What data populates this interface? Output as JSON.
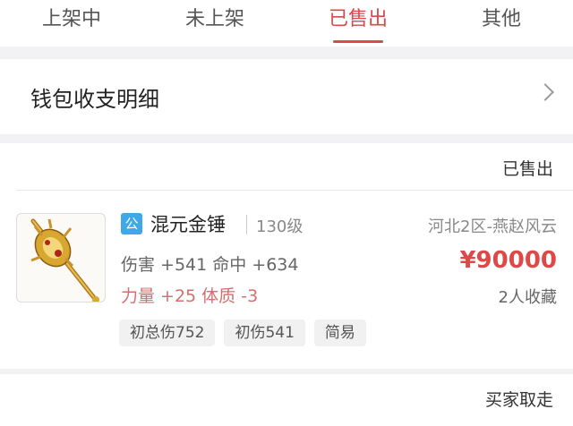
{
  "tabs": [
    {
      "label": "上架中"
    },
    {
      "label": "未上架"
    },
    {
      "label": "已售出"
    },
    {
      "label": "其他"
    }
  ],
  "active_tab": "已售出",
  "wallet": {
    "label": "钱包收支明细",
    "icon": "chevron-right-icon"
  },
  "order": {
    "status": "已售出",
    "item": {
      "badge": "公",
      "name": "混元金锤",
      "level": "130级",
      "server": "河北2区-燕赵风云",
      "stats_line1": "伤害 +541 命中 +634",
      "stats_line2": "力量 +25 体质 -3",
      "price": "¥90000",
      "favorites": "2人收藏",
      "tags": [
        "初总伤752",
        "初伤541",
        "简易"
      ],
      "image": "golden-mace-icon"
    }
  },
  "order2": {
    "status": "买家取走"
  },
  "colors": {
    "accent": "#d94a4a",
    "price": "#e04848",
    "badge": "#3fa8e6",
    "stat_highlight": "#d07070"
  }
}
